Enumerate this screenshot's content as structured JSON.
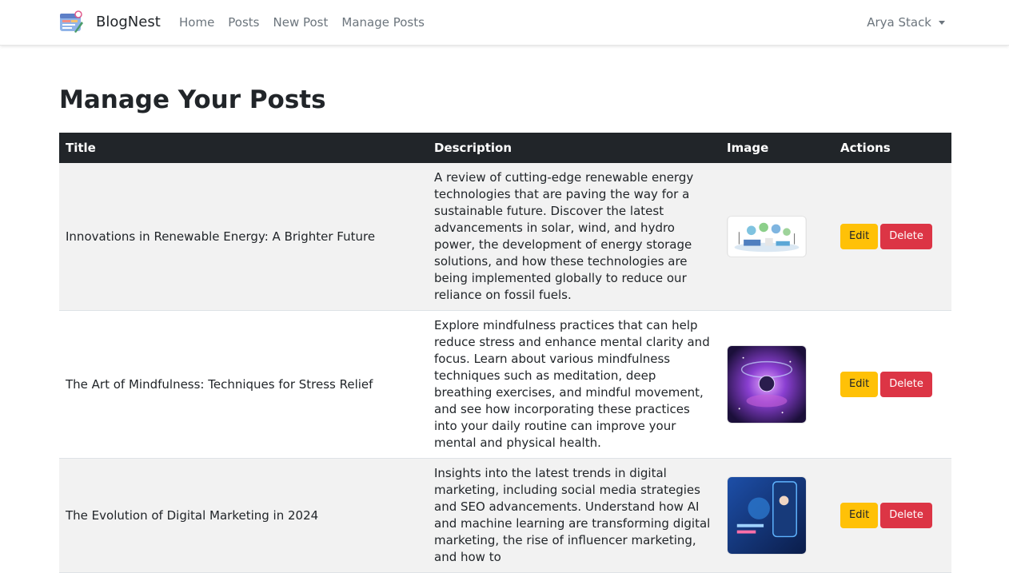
{
  "navbar": {
    "brand_icon": "blog-logo-icon",
    "brand_name": "BlogNest",
    "links": [
      "Home",
      "Posts",
      "New Post",
      "Manage Posts"
    ],
    "user_name": "Arya Stack",
    "user_menu_icon": "caret-down-icon"
  },
  "page": {
    "title": "Manage Your Posts"
  },
  "table": {
    "headers": [
      "Title",
      "Description",
      "Image",
      "Actions"
    ],
    "rows": [
      {
        "title": "Innovations in Renewable Energy: A Brighter Future",
        "description": "A review of cutting-edge renewable energy technologies that are paving the way for a sustainable future. Discover the latest advancements in solar, wind, and hydro power, the development of energy storage solutions, and how these technologies are being implemented globally to reduce our reliance on fossil fuels.",
        "image_icon": "renewable-energy-illustration",
        "edit_label": "Edit",
        "delete_label": "Delete"
      },
      {
        "title": "The Art of Mindfulness: Techniques for Stress Relief",
        "description": "Explore mindfulness practices that can help reduce stress and enhance mental clarity and focus. Learn about various mindfulness techniques such as meditation, deep breathing exercises, and mindful movement, and see how incorporating these practices into your daily routine can improve your mental and physical health.",
        "image_icon": "cosmic-meditation-illustration",
        "edit_label": "Edit",
        "delete_label": "Delete"
      },
      {
        "title": "The Evolution of Digital Marketing in 2024",
        "description": "Insights into the latest trends in digital marketing, including social media strategies and SEO advancements. Understand how AI and machine learning are transforming digital marketing, the rise of influencer marketing, and how to",
        "image_icon": "digital-marketing-illustration",
        "edit_label": "Edit",
        "delete_label": "Delete"
      }
    ]
  },
  "colors": {
    "header_bg": "#212529",
    "edit_button": "#ffc107",
    "delete_button": "#dc3545",
    "striped_row": "#f2f2f2"
  }
}
